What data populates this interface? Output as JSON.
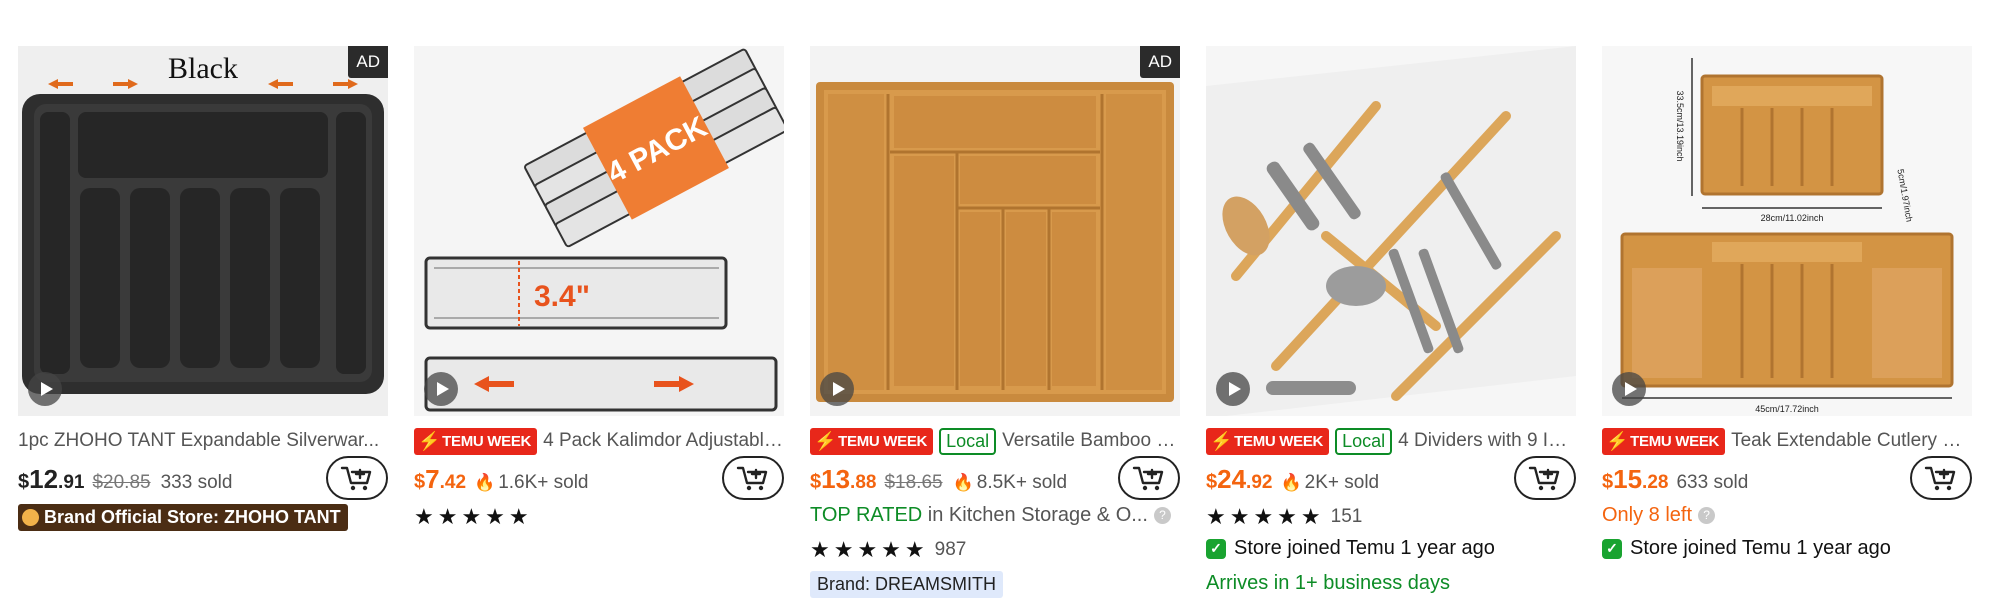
{
  "products": [
    {
      "title": "1pc ZHOHO TANT Expandable Silverwar...",
      "ad_label": "AD",
      "image_text": "Black",
      "price_cur": "$",
      "price_int": "12",
      "price_dec": ".91",
      "orig_price": "$20.85",
      "sold": "333 sold",
      "brand_store": "Brand Official Store: ZHOHO TANT"
    },
    {
      "title": "4 Pack Kalimdor Adjustable ...",
      "badge_temu": "TEMU WEEK",
      "image_text_pack": "4 PACK",
      "image_text_height": "3.4\"",
      "price_cur": "$",
      "price_int": "7",
      "price_dec": ".42",
      "sold": "1.6K+ sold",
      "stars": "★★★★★"
    },
    {
      "title": "Versatile Bamboo Exp...",
      "ad_label": "AD",
      "badge_temu": "TEMU WEEK",
      "badge_local": "Local",
      "price_cur": "$",
      "price_int": "13",
      "price_dec": ".88",
      "orig_price": "$18.65",
      "sold": "8.5K+ sold",
      "top_rated": "TOP RATED",
      "top_rated_rest": " in Kitchen Storage & O...",
      "stars": "★★★★★",
      "reviews": "987",
      "brand": "Brand: DREAMSMITH"
    },
    {
      "title": "4 Dividers with 9 Inse...",
      "badge_temu": "TEMU WEEK",
      "badge_local": "Local",
      "price_cur": "$",
      "price_int": "24",
      "price_dec": ".92",
      "sold": "2K+ sold",
      "stars": "★★★★★",
      "reviews": "151",
      "store_joined": "Store joined Temu 1 year ago",
      "arrives": "Arrives in 1+ business days"
    },
    {
      "title": "Teak Extendable Cutlery Stor...",
      "badge_temu": "TEMU WEEK",
      "price_cur": "$",
      "price_int": "15",
      "price_dec": ".28",
      "sold": "633 sold",
      "only_left": "Only 8 left",
      "store_joined": "Store joined Temu 1 year ago",
      "dim_a": "33.5cm/13.19inch",
      "dim_b": "28cm/11.02inch",
      "dim_c": "5cm/1.97inch",
      "dim_d": "45cm/17.72inch"
    }
  ],
  "colors": {
    "price_orange": "#f4640f",
    "temu_red": "#e8271a",
    "local_green": "#0d8c26"
  },
  "icons": {
    "cart": "add-to-cart-icon",
    "play": "play-icon",
    "flame": "flame-icon",
    "store": "store-check-icon"
  }
}
